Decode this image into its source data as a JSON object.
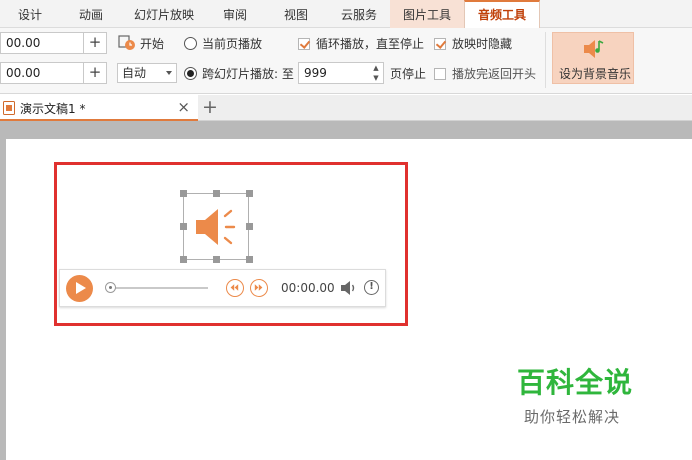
{
  "ribbon_tabs": [
    "设计",
    "动画",
    "幻灯片放映",
    "审阅",
    "视图",
    "云服务",
    "图片工具",
    "音频工具"
  ],
  "toolbar": {
    "volume_value": "00.00",
    "fade_value": "00.00",
    "start_label": "开始",
    "start_mode": "自动",
    "current_page_label": "当前页播放",
    "cross_slide_label": "跨幻灯片播放: 至",
    "stop_page_value": "999",
    "page_stop_label": "页停止",
    "loop_label": "循环播放，直至停止",
    "hide_label": "放映时隐藏",
    "rewind_label": "播放完返回开头",
    "set_bg_music_label": "设为背景音乐"
  },
  "document": {
    "tab_name": "演示文稿1 *",
    "close_glyph": "×",
    "new_tab_glyph": "+"
  },
  "player": {
    "time": "00:00.00",
    "info_glyph": "!"
  },
  "watermark": {
    "title": "百科全说",
    "subtitle": "助你轻松解决"
  },
  "colors": {
    "accent": "#e07a3c",
    "speaker": "#ec8a4a",
    "highlight_box": "#e0312f",
    "watermark": "#2fb63c"
  }
}
